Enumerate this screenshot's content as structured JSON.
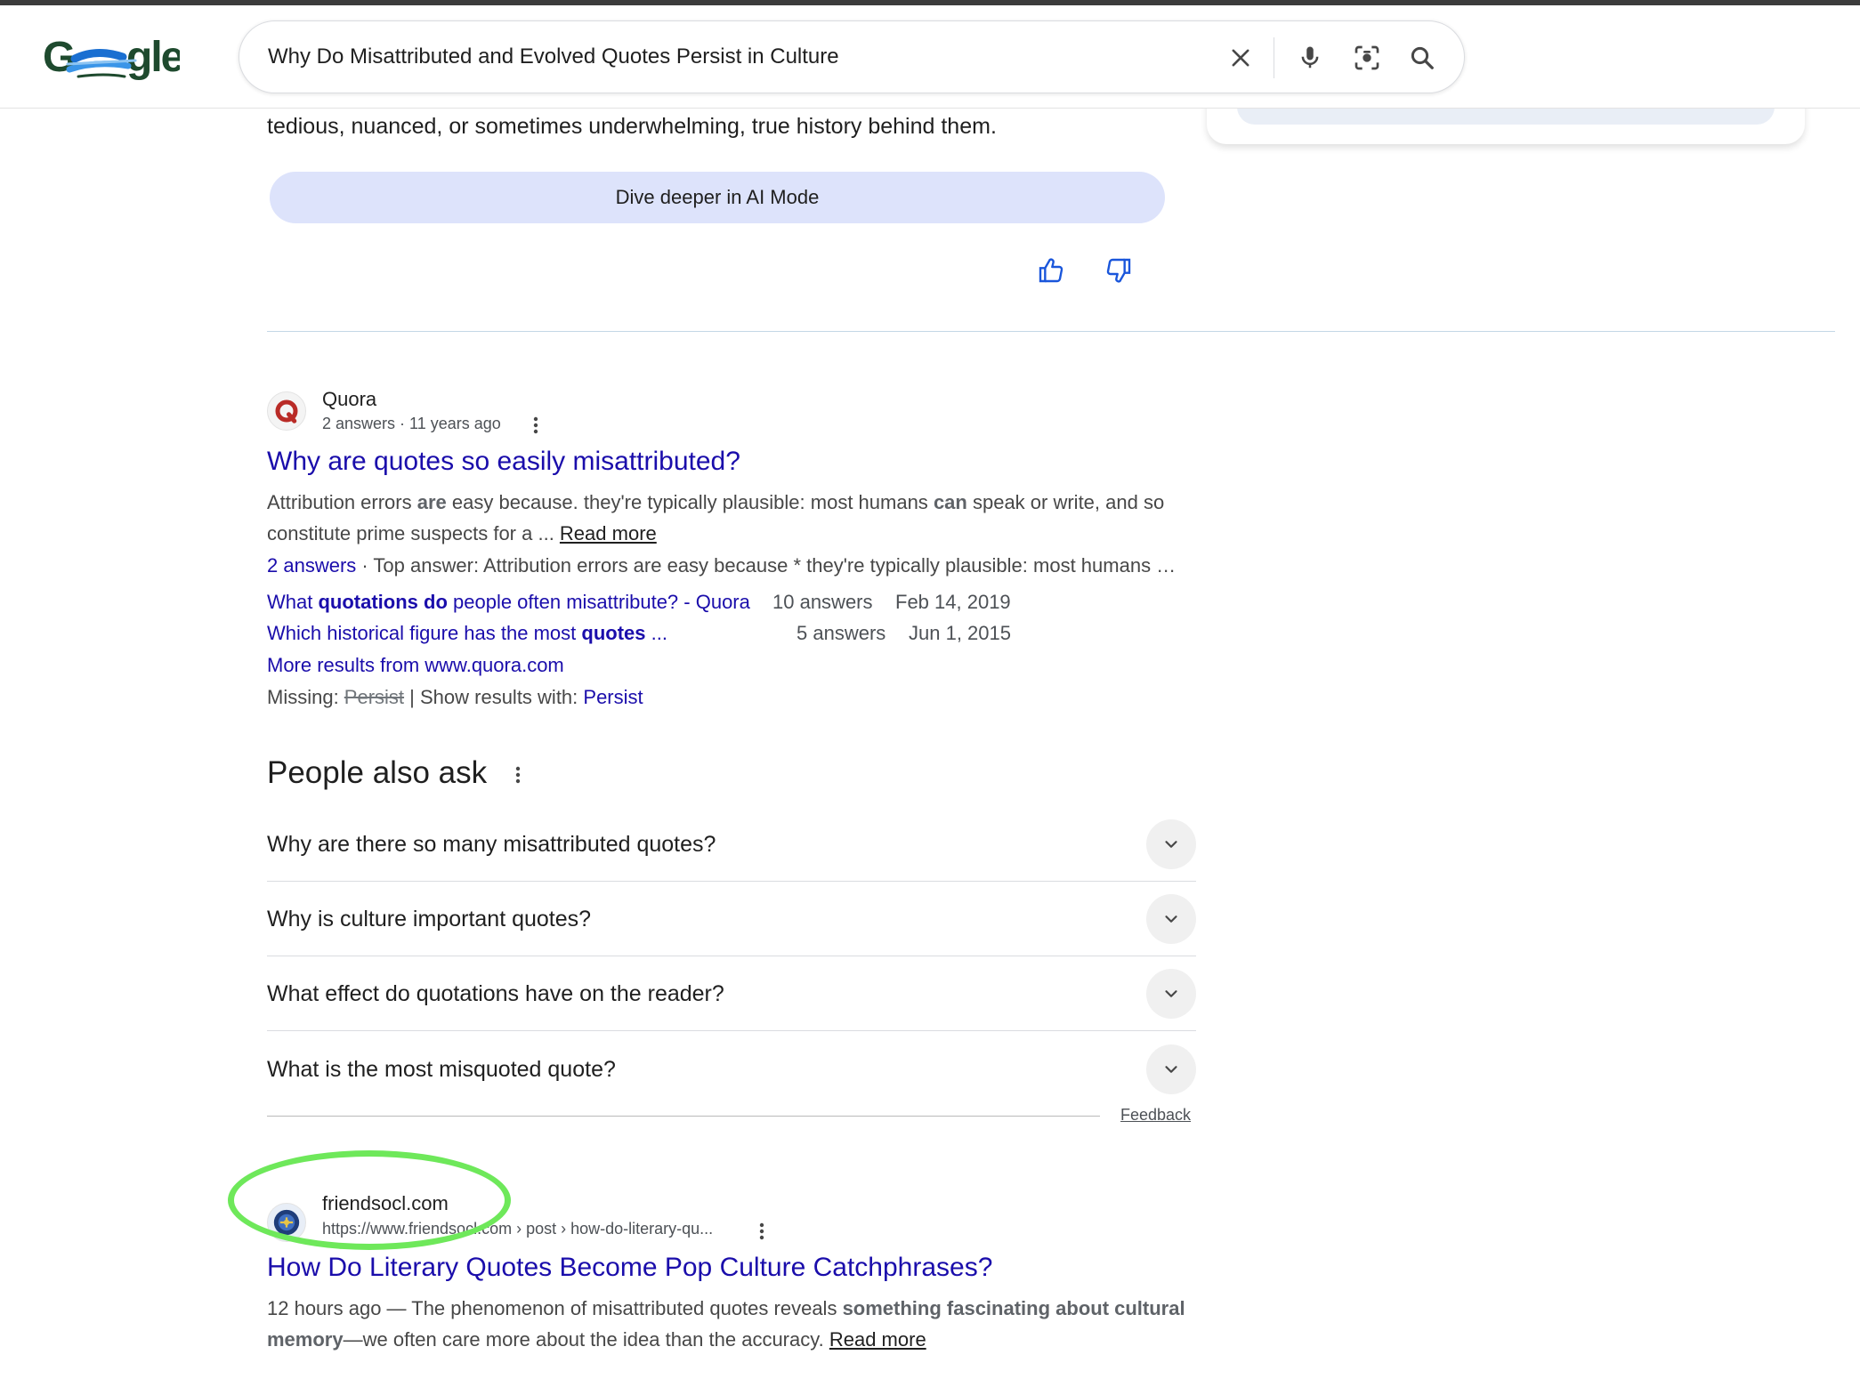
{
  "colors": {
    "link": "#1a0dab",
    "ai_button_bg": "#dde3fb",
    "highlight": "#6ee85a",
    "text": "#1f1f1f"
  },
  "header": {
    "logo_text": "Google",
    "search_query": "Why Do Misattributed and Evolved Quotes Persist in Culture",
    "icons": [
      "close-icon",
      "microphone-icon",
      "lens-icon",
      "search-icon"
    ]
  },
  "ai_overview": {
    "tail_text": "tedious, nuanced, or sometimes underwhelming, true history behind them.",
    "dive_button": "Dive deeper in AI Mode",
    "feedback_icons": [
      "thumbs-up-icon",
      "thumbs-down-icon"
    ]
  },
  "quora_result": {
    "site": "Quora",
    "meta": "2 answers · 11 years ago",
    "title": "Why are quotes so easily misattributed?",
    "snippet_1a": "Attribution errors ",
    "snippet_1b": "are",
    "snippet_1c": " easy because. they're typically plausible: most humans ",
    "snippet_1d": "can",
    "snippet_1e": " speak or write, and so",
    "snippet_2": "constitute prime suspects for a ... ",
    "read_more": "Read more",
    "answers_link": "2 answers",
    "top_answer": " · Top answer: Attribution errors are easy because * they're typically plausible: most humans …",
    "sub_results": [
      {
        "title_a": "What ",
        "title_b": "quotations do",
        "title_c": " people often misattribute? - Quora",
        "answers": "10 answers",
        "date": "Feb 14, 2019"
      },
      {
        "title_a": "Which historical figure has the most ",
        "title_b": "quotes",
        "title_c": " ...",
        "answers": "5 answers",
        "date": "Jun 1, 2015"
      }
    ],
    "more_results": "More results from www.quora.com",
    "missing_label": "Missing: ",
    "missing_term": "Persist",
    "show_with_label": " | Show results with: ",
    "show_with_term": "Persist"
  },
  "people_also_ask": {
    "title": "People also ask",
    "questions": [
      "Why are there so many misattributed quotes?",
      "Why is culture important quotes?",
      "What effect do quotations have on the reader?",
      "What is the most misquoted quote?"
    ],
    "feedback": "Feedback"
  },
  "friendsocl_result": {
    "site": "friendsocl.com",
    "url": "https://www.friendsocl.com › post › how-do-literary-qu...",
    "title": "How Do Literary Quotes Become Pop Culture Catchphrases?",
    "snippet_1a": "12 hours ago — The phenomenon of misattributed quotes reveals ",
    "snippet_1b": "something fascinating about cultural",
    "snippet_2a": "memory",
    "snippet_2b": "—we often care more about the idea than the accuracy. ",
    "read_more": "Read more"
  }
}
